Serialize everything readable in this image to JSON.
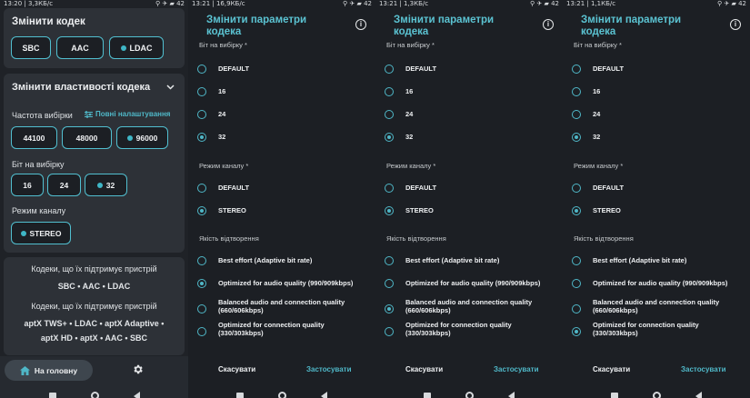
{
  "phone1": {
    "status": {
      "time": "13:20 | 3,3КБ/с",
      "icons": "⚲ ✈ ▰ 42"
    },
    "change_codec": {
      "title": "Змінити кодек",
      "codecs": [
        "SBC",
        "AAC",
        "LDAC"
      ],
      "selected": "LDAC"
    },
    "codec_props": {
      "title": "Змінити властивості кодека",
      "sample_rate_label": "Частота вибірки",
      "full_settings": "Повні налаштування",
      "sample_rates": [
        "44100",
        "48000",
        "96000"
      ],
      "sample_rate_selected": "96000",
      "bits_label": "Біт на вибірку",
      "bits": [
        "16",
        "24",
        "32"
      ],
      "bits_selected": "32",
      "channel_label": "Режим каналу",
      "channel": "STEREO"
    },
    "info": {
      "supported_label_1": "Кодеки, що їх підтримує пристрій",
      "supported_1": "SBC • AAC • LDAC",
      "supported_label_2": "Кодеки, що їх підтримує пристрій",
      "supported_2a": "aptX TWS+ • LDAC • aptX Adaptive •",
      "supported_2b": "aptX HD • aptX • AAC • SBC"
    },
    "bottom": {
      "home": "На головну"
    }
  },
  "dialogs": [
    {
      "status": "13:21 | 16,9КБ/с",
      "icons": "⚲ ✈ ▰ 42",
      "title_1": "Змінити параметри",
      "title_2": "кодека",
      "bits_label": "Біт на вибірку *",
      "bits": [
        "DEFAULT",
        "16",
        "24",
        "32"
      ],
      "bits_selected": 3,
      "channel_label": "Режим каналу *",
      "channel": [
        "DEFAULT",
        "STEREO"
      ],
      "channel_selected": 1,
      "quality_label": "Якість відтворення",
      "quality": [
        "Best effort (Adaptive bit rate)",
        "Optimized for audio quality (990/909kbps)",
        "Balanced audio and connection quality",
        "(660/606kbps)",
        "Optimized for connection quality",
        "(330/303kbps)"
      ],
      "quality_selected": 1,
      "cancel": "Скасувати",
      "apply": "Застосувати"
    },
    {
      "status": "13:21 | 1,3КБ/с",
      "icons": "⚲ ✈ ▰ 42",
      "title_1": "Змінити параметри",
      "title_2": "кодека",
      "bits_label": "Біт на вибірку *",
      "bits": [
        "DEFAULT",
        "16",
        "24",
        "32"
      ],
      "bits_selected": 3,
      "channel_label": "Режим каналу *",
      "channel": [
        "DEFAULT",
        "STEREO"
      ],
      "channel_selected": 1,
      "quality_label": "Якість відтворення",
      "quality": [
        "Best effort (Adaptive bit rate)",
        "Optimized for audio quality (990/909kbps)",
        "Balanced audio and connection quality",
        "(660/606kbps)",
        "Optimized for connection quality",
        "(330/303kbps)"
      ],
      "quality_selected": 2,
      "cancel": "Скасувати",
      "apply": "Застосувати"
    },
    {
      "status": "13:21 | 1,1КБ/с",
      "icons": "⚲ ✈ ▰ 42",
      "title_1": "Змінити параметри",
      "title_2": "кодека",
      "bits_label": "Біт на вибірку *",
      "bits": [
        "DEFAULT",
        "16",
        "24",
        "32"
      ],
      "bits_selected": 3,
      "channel_label": "Режим каналу *",
      "channel": [
        "DEFAULT",
        "STEREO"
      ],
      "channel_selected": 1,
      "quality_label": "Якість відтворення",
      "quality": [
        "Best effort (Adaptive bit rate)",
        "Optimized for audio quality (990/909kbps)",
        "Balanced audio and connection quality",
        "(660/606kbps)",
        "Optimized for connection quality",
        "(330/303kbps)"
      ],
      "quality_selected": 3,
      "cancel": "Скасувати",
      "apply": "Застосувати"
    }
  ],
  "colors": {
    "accent": "#4fb7c7",
    "card": "#2d3137",
    "background": "#1c1f24"
  }
}
